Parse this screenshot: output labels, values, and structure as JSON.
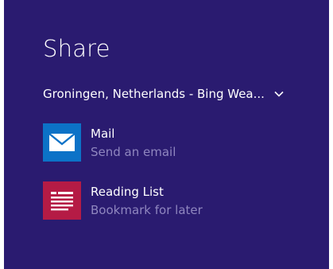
{
  "colors": {
    "background": "#2a1b70",
    "mail_tile": "#0c72c7",
    "reading_list_tile": "#b51b45",
    "secondary_text": "#8f86bf"
  },
  "charm": {
    "title": "Share",
    "source": {
      "label": "Groningen, Netherlands - Bing Wea...",
      "icon": "chevron-down-icon"
    },
    "targets": [
      {
        "name": "Mail",
        "description": "Send an email",
        "icon": "mail-icon"
      },
      {
        "name": "Reading List",
        "description": "Bookmark for later",
        "icon": "reading-list-icon"
      }
    ]
  }
}
